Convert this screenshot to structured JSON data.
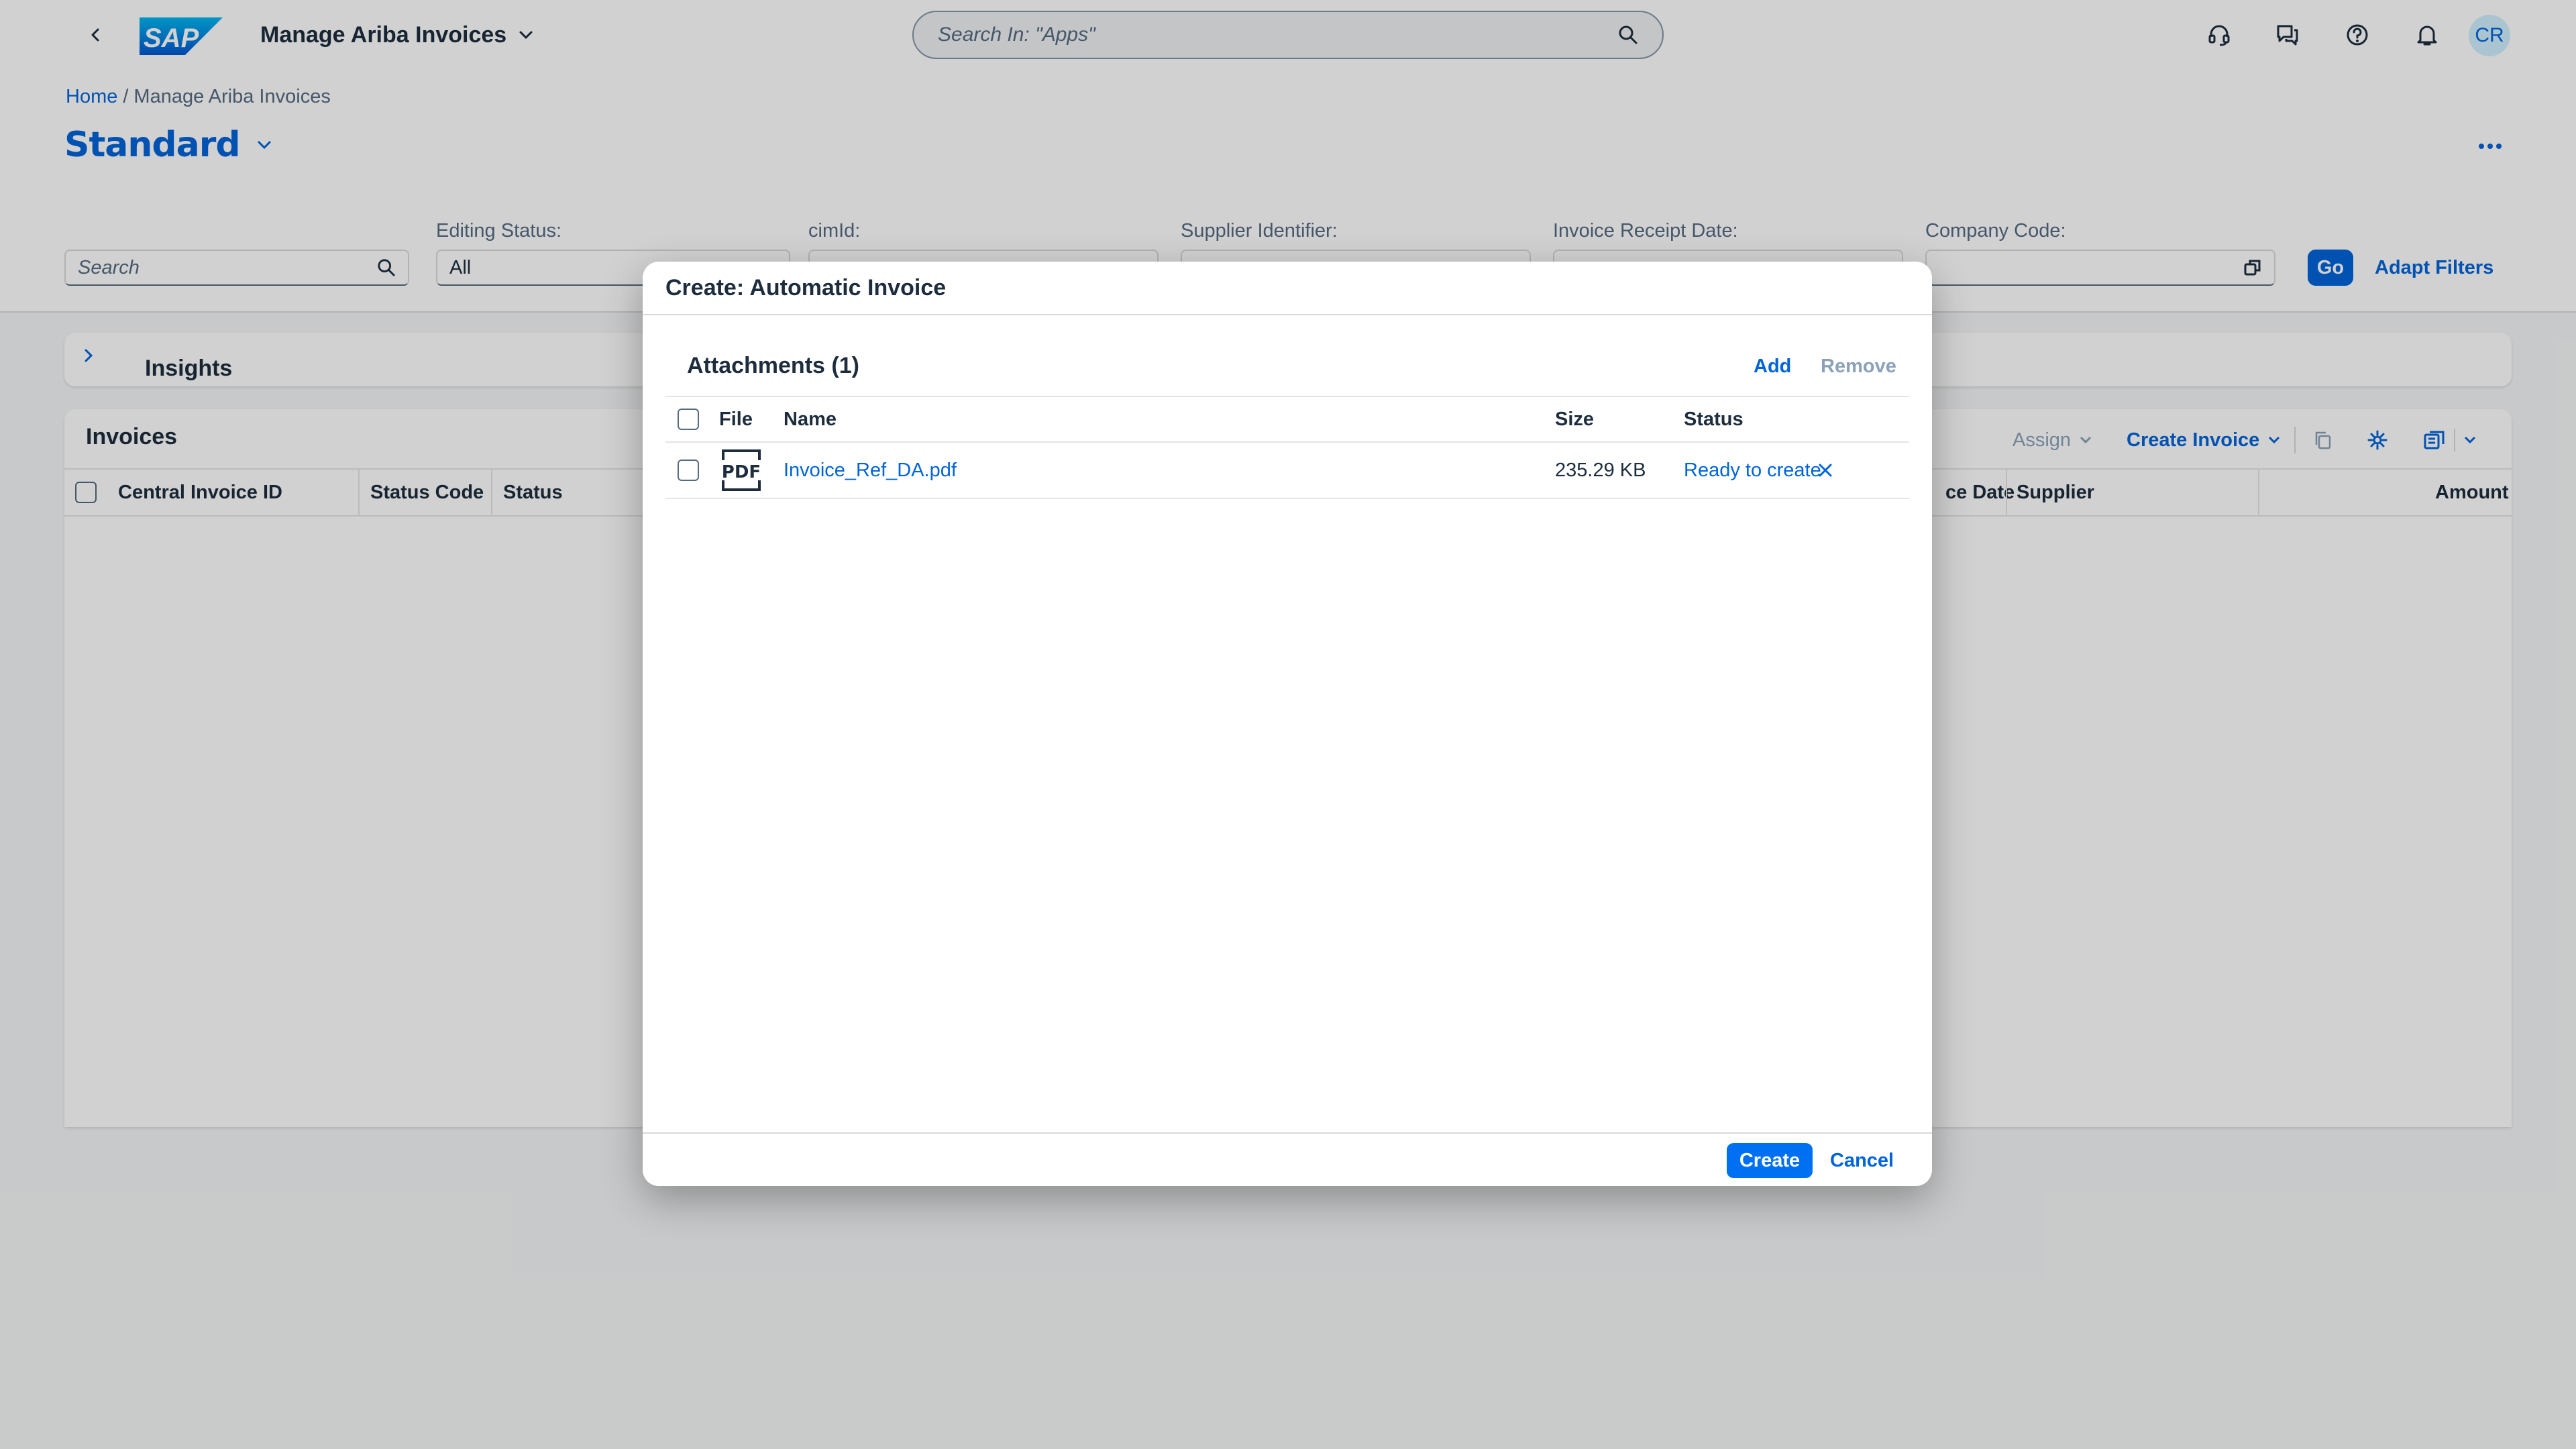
{
  "shell": {
    "logo_text": "SAP",
    "app_title": "Manage Ariba Invoices",
    "search_placeholder": "Search In: \"Apps\"",
    "avatar_initials": "CR",
    "colors": {
      "brand": "#0064d9",
      "avatar_bg": "#d1efff"
    }
  },
  "breadcrumb": {
    "home": "Home",
    "separator": "/",
    "current": "Manage Ariba Invoices"
  },
  "variant": {
    "name": "Standard"
  },
  "filters": {
    "search_placeholder": "Search",
    "editing_status": {
      "label": "Editing Status:",
      "value": "All"
    },
    "cim_id": {
      "label": "cimId:"
    },
    "supplier_identifier": {
      "label": "Supplier Identifier:"
    },
    "invoice_receipt_date": {
      "label": "Invoice Receipt Date:"
    },
    "company_code": {
      "label": "Company Code:"
    },
    "go_label": "Go",
    "adapt_filters_label": "Adapt Filters"
  },
  "insights": {
    "title": "Insights"
  },
  "invoices": {
    "title": "Invoices",
    "toolbar": {
      "assign": "Assign",
      "create_invoice": "Create Invoice"
    },
    "columns": {
      "central_invoice_id": "Central Invoice ID",
      "status_code": "Status Code",
      "status": "Status",
      "date_partial": "ce Date",
      "supplier": "Supplier",
      "amount": "Amount"
    }
  },
  "dialog": {
    "title": "Create: Automatic Invoice",
    "attachments_title": "Attachments (1)",
    "add_label": "Add",
    "remove_label": "Remove",
    "columns": {
      "file": "File",
      "name": "Name",
      "size": "Size",
      "status": "Status"
    },
    "rows": [
      {
        "name": "Invoice_Ref_DA.pdf",
        "size": "235.29 KB",
        "status": "Ready to create",
        "file_icon": "pdf-file-icon"
      }
    ],
    "create_label": "Create",
    "cancel_label": "Cancel"
  }
}
